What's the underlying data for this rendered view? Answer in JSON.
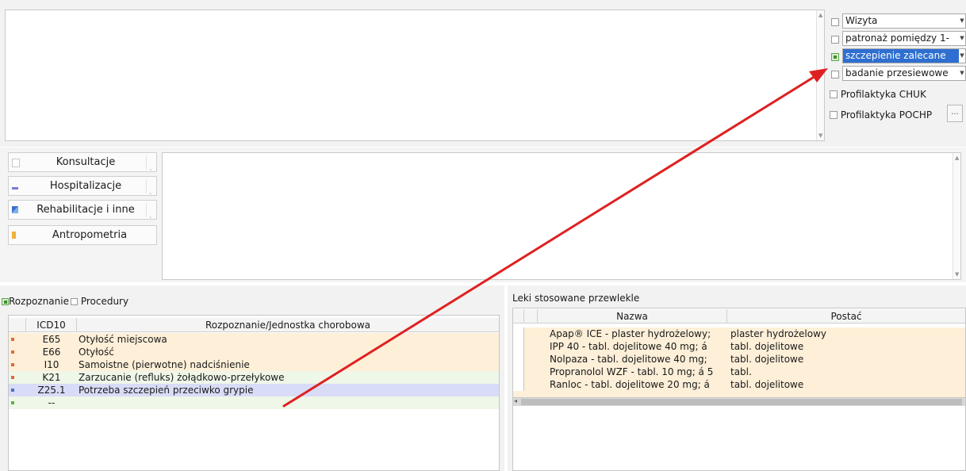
{
  "visit_types": [
    {
      "label": "Wizyta",
      "checked": false,
      "selected": false
    },
    {
      "label": "patronaż pomiędzy 1-",
      "checked": false,
      "selected": false
    },
    {
      "label": "szczepienie zalecane",
      "checked": true,
      "selected": true
    },
    {
      "label": "badanie przesiewowe",
      "checked": false,
      "selected": false
    }
  ],
  "prophylaxis": [
    {
      "label": "Profilaktyka CHUK"
    },
    {
      "label": "Profilaktyka POCHP"
    }
  ],
  "ellipsis_label": "...",
  "side_buttons": [
    {
      "label": "Konsultacje",
      "icon": "document-icon"
    },
    {
      "label": "Hospitalizacje",
      "icon": "bed-icon"
    },
    {
      "label": "Rehabilitacje i inne",
      "icon": "chart-icon"
    },
    {
      "label": "Antropometria",
      "icon": "ruler-icon"
    }
  ],
  "diagnosis_tabs": {
    "diagnosis": "Rozpoznanie",
    "procedures": "Procedury"
  },
  "diagnosis_columns": {
    "code": "ICD10",
    "name": "Rozpoznanie/Jednostka chorobowa"
  },
  "diagnoses": [
    {
      "code": "E65",
      "name": "Otyłość miejscowa",
      "bullet_color": "#e06a3a",
      "row_color": "#fdefd8",
      "selected": false
    },
    {
      "code": "E66",
      "name": "Otyłość",
      "bullet_color": "#e06a3a",
      "row_color": "#fdefd8",
      "selected": false
    },
    {
      "code": "I10",
      "name": "Samoistne (pierwotne) nadciśnienie",
      "bullet_color": "#e06a3a",
      "row_color": "#fdefd8",
      "selected": false
    },
    {
      "code": "K21",
      "name": "Zarzucanie (refluks) żołądkowo-przełykowe",
      "bullet_color": "#e06a3a",
      "row_color": "#eef7e8",
      "selected": false
    },
    {
      "code": "Z25.1",
      "name": "Potrzeba szczepień przeciwko grypie",
      "bullet_color": "#4a72c8",
      "row_color": "#d9dcf7",
      "selected": true
    },
    {
      "code": "--",
      "name": "",
      "bullet_color": "#5fb24a",
      "row_color": "#eef7e8",
      "selected": false
    }
  ],
  "meds_title": "Leki stosowane przewlekle",
  "meds_columns": {
    "name": "Nazwa",
    "form": "Postać"
  },
  "meds": [
    {
      "name": "Apap® ICE - plaster hydrożelowy;",
      "form": "plaster hydrożelowy"
    },
    {
      "name": "IPP 40 - tabl. dojelitowe 40 mg; á",
      "form": "tabl. dojelitowe"
    },
    {
      "name": "Nolpaza - tabl. dojelitowe 40 mg;",
      "form": "tabl. dojelitowe"
    },
    {
      "name": "Propranolol WZF - tabl. 10 mg; á 5",
      "form": "tabl."
    },
    {
      "name": "Ranloc - tabl. dojelitowe 20 mg; á",
      "form": "tabl. dojelitowe"
    }
  ],
  "colors": {
    "annotation_arrow": "#e02020",
    "selection": "#2e6fd1",
    "meds_row": "#fdefd8"
  }
}
